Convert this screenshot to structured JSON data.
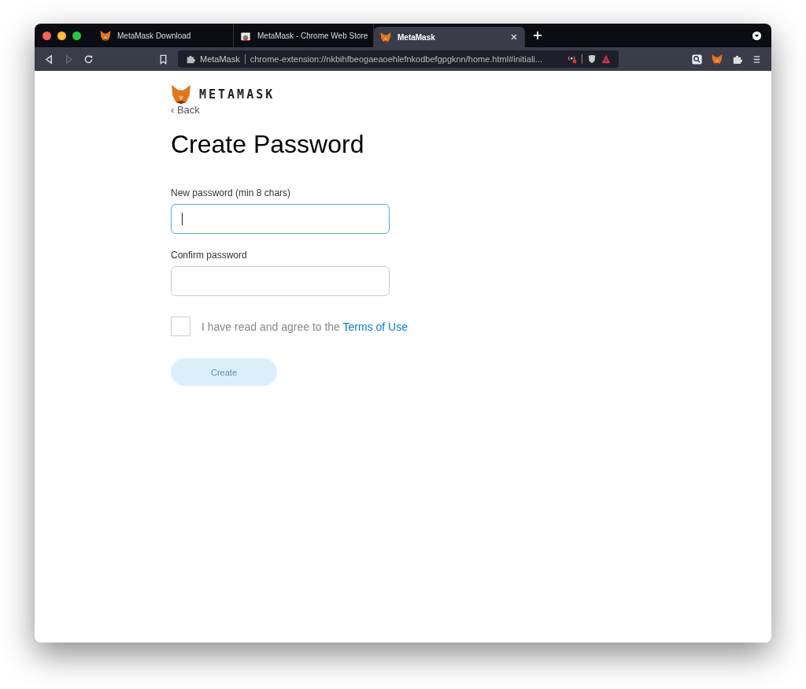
{
  "browser": {
    "tabs": [
      {
        "title": "MetaMask Download",
        "kind": "fox",
        "selected": false
      },
      {
        "title": "MetaMask - Chrome Web Store",
        "kind": "store",
        "selected": false
      },
      {
        "title": "MetaMask",
        "kind": "fox",
        "selected": true
      }
    ],
    "address_bar": {
      "site": "MetaMask",
      "url": "chrome-extension://nkbihfbeogaeaoehlefnkodbefgpgknn/home.html#initiali..."
    }
  },
  "page": {
    "logo": "METAMASK",
    "back": "‹ Back",
    "title": "Create Password",
    "fields": [
      {
        "label": "New password (min 8 chars)",
        "focused": true
      },
      {
        "label": "Confirm password",
        "focused": false
      }
    ],
    "agree": {
      "checked": false,
      "text": "I have read and agree to the ",
      "link": "Terms of Use"
    },
    "create_button": {
      "label": "Create",
      "disabled": true
    }
  }
}
